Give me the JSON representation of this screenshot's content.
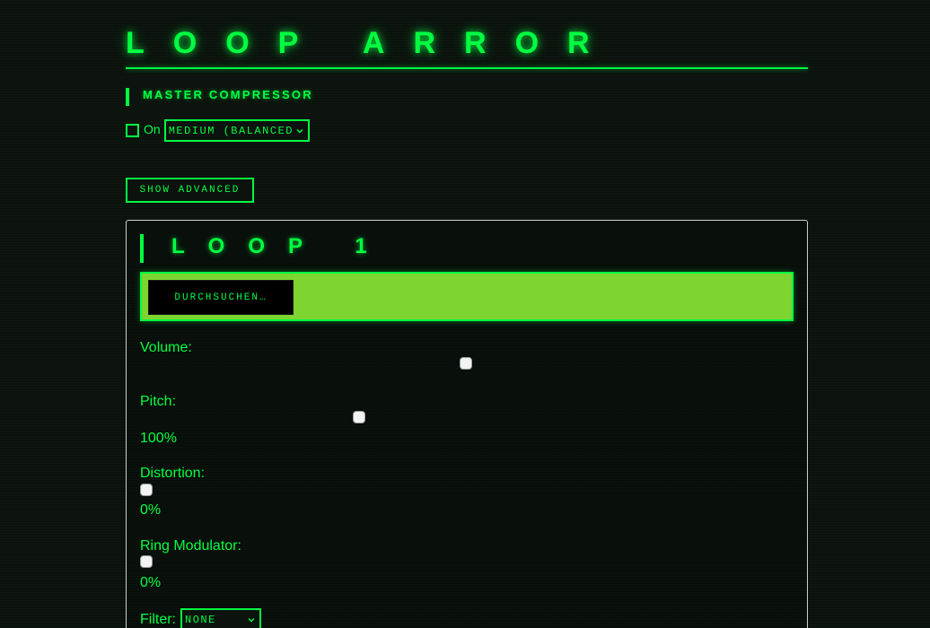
{
  "app": {
    "title": "LOOP ARROR"
  },
  "compressor": {
    "heading": "MASTER COMPRESSOR",
    "on_label": "On",
    "on_checked": false,
    "preset_value": "MEDIUM (BALANCED)"
  },
  "advanced": {
    "button_label": "SHOW ADVANCED"
  },
  "loop": {
    "title": "LOOP 1",
    "browse_label": "DURCHSUCHEN…",
    "volume": {
      "label": "Volume:",
      "fraction": 0.5
    },
    "pitch": {
      "label": "Pitch:",
      "value_text": "100%",
      "fraction": 0.333
    },
    "distortion": {
      "label": "Distortion:",
      "value_text": "0%",
      "fraction": 0
    },
    "ring_modulator": {
      "label": "Ring Modulator:",
      "value_text": "0%",
      "fraction": 0
    },
    "filter": {
      "label": "Filter:",
      "value": "NONE"
    }
  },
  "colors": {
    "accent": "#00ff41",
    "panel_bar": "#7ed52f",
    "background": "#0c120e"
  }
}
